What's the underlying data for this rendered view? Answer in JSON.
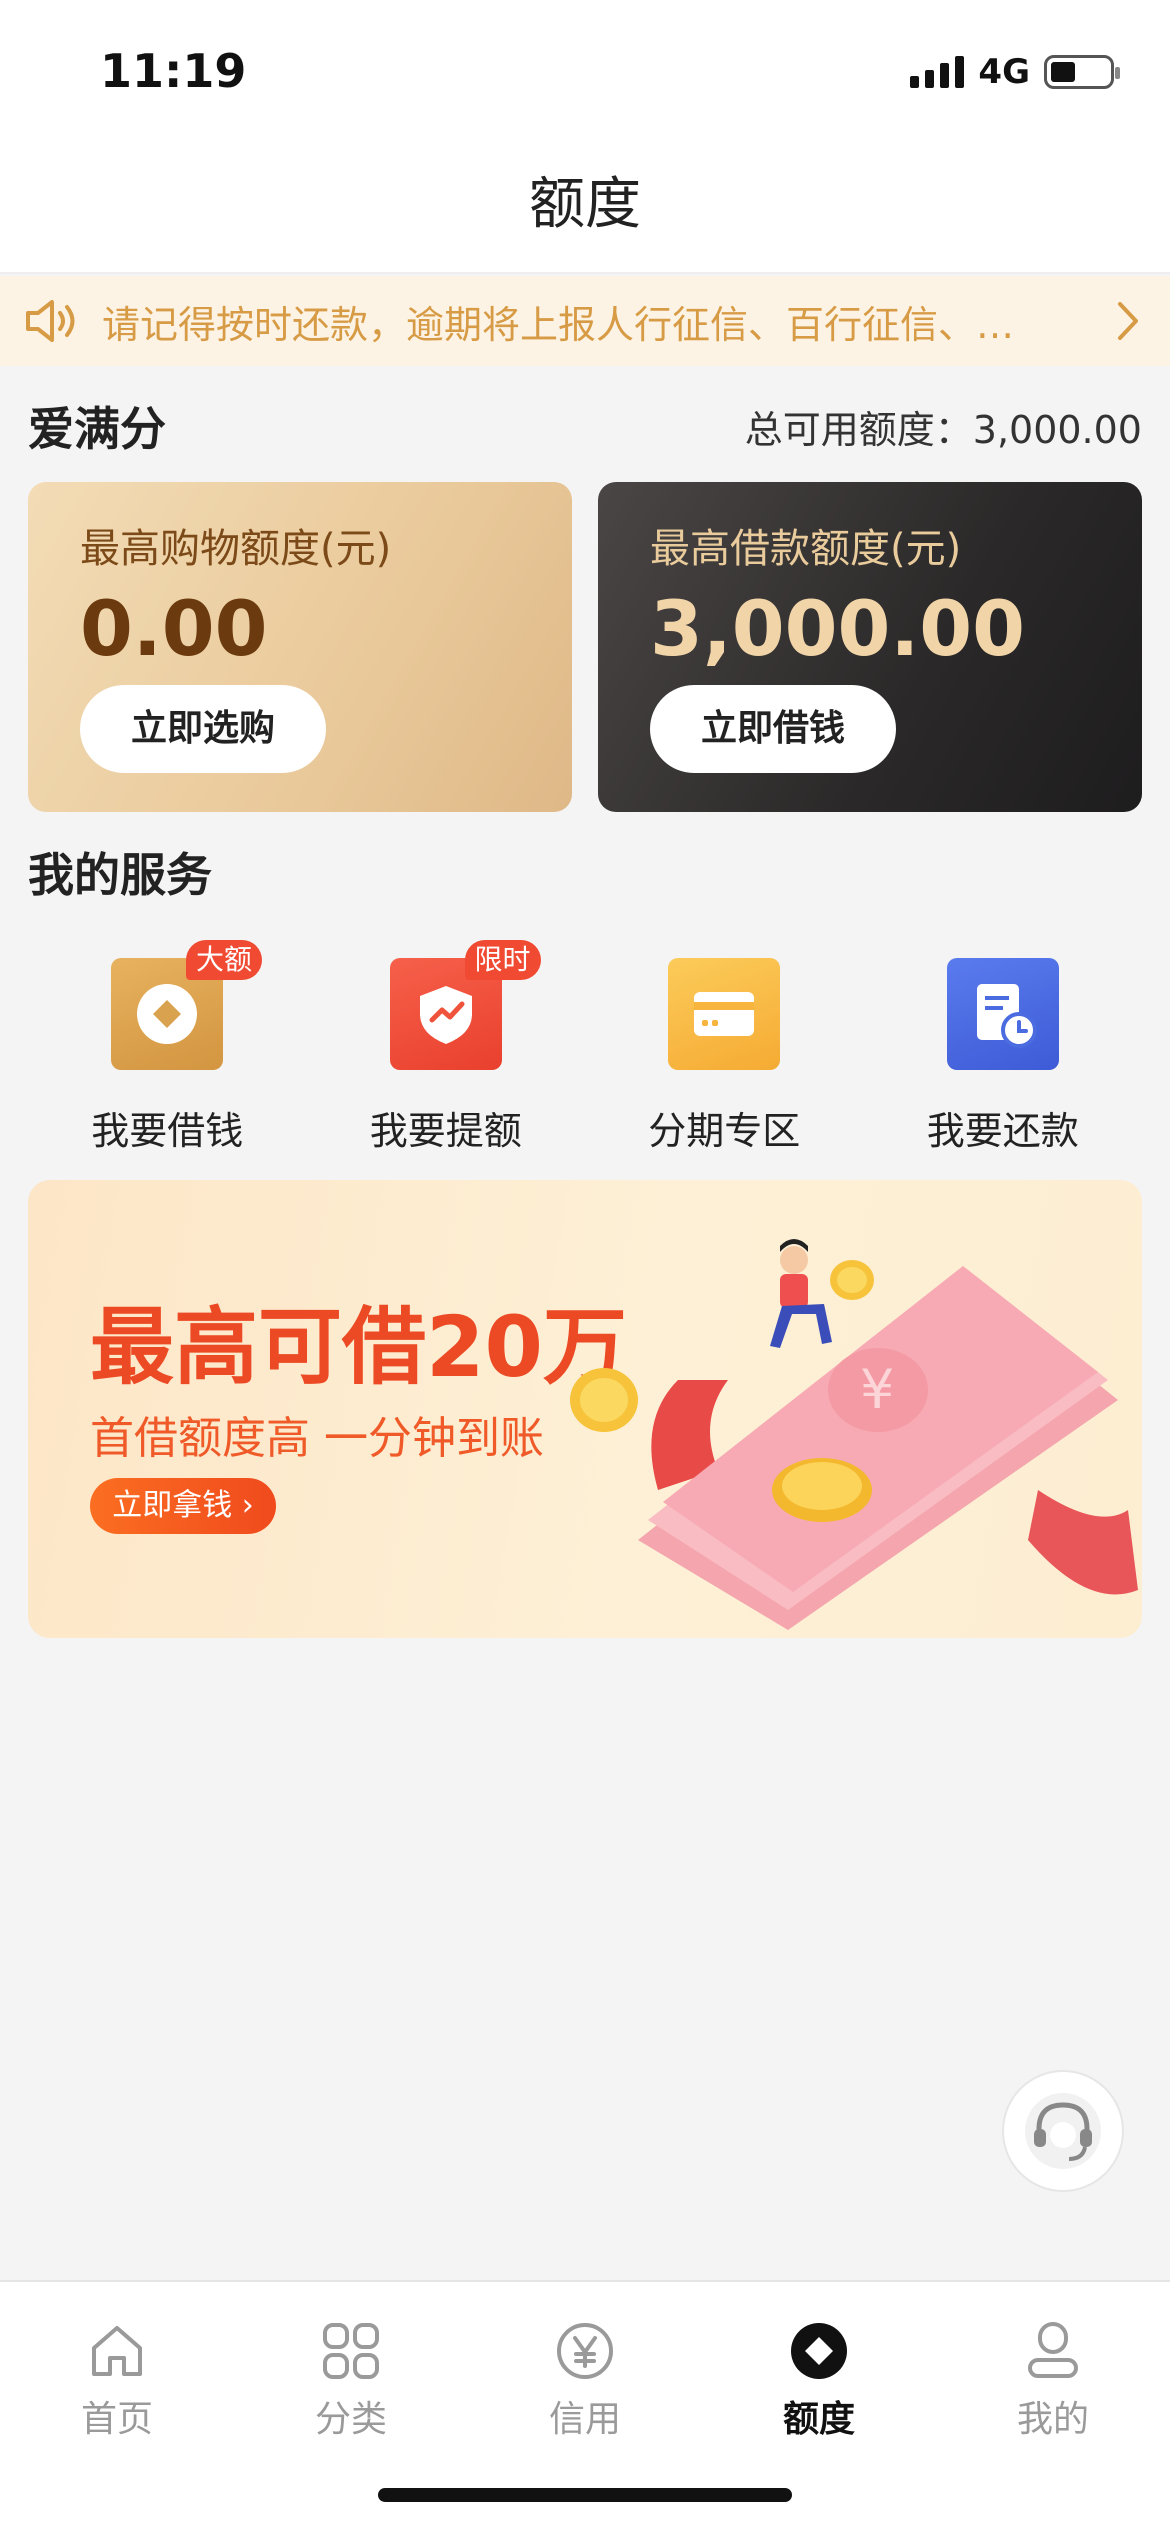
{
  "status_bar": {
    "time": "11:19",
    "network": "4G"
  },
  "nav": {
    "title": "额度"
  },
  "notice": {
    "text": "请记得按时还款，逾期将上报人行征信、百行征信、…"
  },
  "score_section": {
    "title": "爱满分",
    "total_label": "总可用额度：3,000.00"
  },
  "cards": {
    "shopping": {
      "label": "最高购物额度(元)",
      "value": "0.00",
      "button": "立即选购"
    },
    "loan": {
      "label": "最高借款额度(元)",
      "value": "3,000.00",
      "button": "立即借钱"
    }
  },
  "services": {
    "title": "我的服务",
    "items": [
      {
        "label": "我要借钱",
        "badge": "大额",
        "icon": "diamond-coin-icon",
        "color": "#d9a24e"
      },
      {
        "label": "我要提额",
        "badge": "限时",
        "icon": "shield-trend-icon",
        "color": "#f0533c"
      },
      {
        "label": "分期专区",
        "badge": "",
        "icon": "card-icon",
        "color": "#f8b53d"
      },
      {
        "label": "我要还款",
        "badge": "",
        "icon": "bill-clock-icon",
        "color": "#4b6be0"
      }
    ]
  },
  "banner": {
    "title": "最高可借20万",
    "subtitle": "首借额度高  一分钟到账",
    "button": "立即拿钱"
  },
  "tabs": [
    {
      "label": "首页",
      "icon": "home-icon",
      "active": false
    },
    {
      "label": "分类",
      "icon": "grid-icon",
      "active": false
    },
    {
      "label": "信用",
      "icon": "yen-circle-icon",
      "active": false
    },
    {
      "label": "额度",
      "icon": "diamond-icon",
      "active": true
    },
    {
      "label": "我的",
      "icon": "user-icon",
      "active": false
    }
  ],
  "colors": {
    "accent_gold": "#d79b45",
    "badge_red": "#f04a32",
    "banner_red": "#ec4a24"
  }
}
